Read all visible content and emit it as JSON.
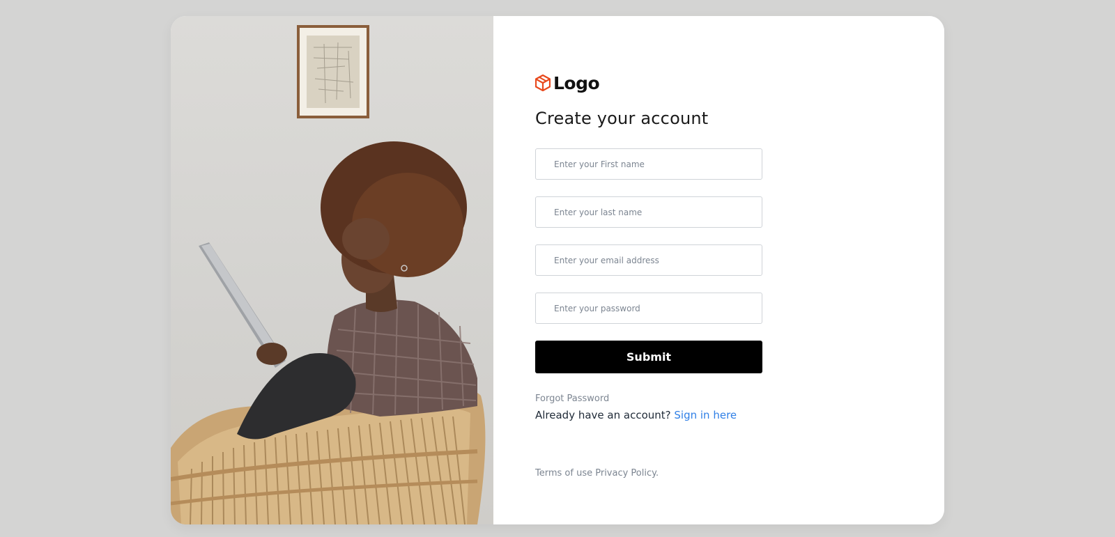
{
  "logo": {
    "text": "Logo",
    "icon": "cube-icon",
    "icon_color": "#e8481c"
  },
  "page_title": "Create your account",
  "form": {
    "first_name_placeholder": "Enter your First name",
    "last_name_placeholder": "Enter your last name",
    "email_placeholder": "Enter your email address",
    "password_placeholder": "Enter your password",
    "submit_label": "Submit"
  },
  "links": {
    "forgot_password": "Forgot Password",
    "already_have_account": "Already have an account?",
    "sign_in": "Sign in here",
    "terms": "Terms of use",
    "privacy": "Privacy Policy."
  },
  "colors": {
    "page_background": "#d4d4d3",
    "card_background": "#ffffff",
    "primary_button": "#000000",
    "link_accent": "#2f7fe6",
    "muted_text": "#7c8591"
  }
}
